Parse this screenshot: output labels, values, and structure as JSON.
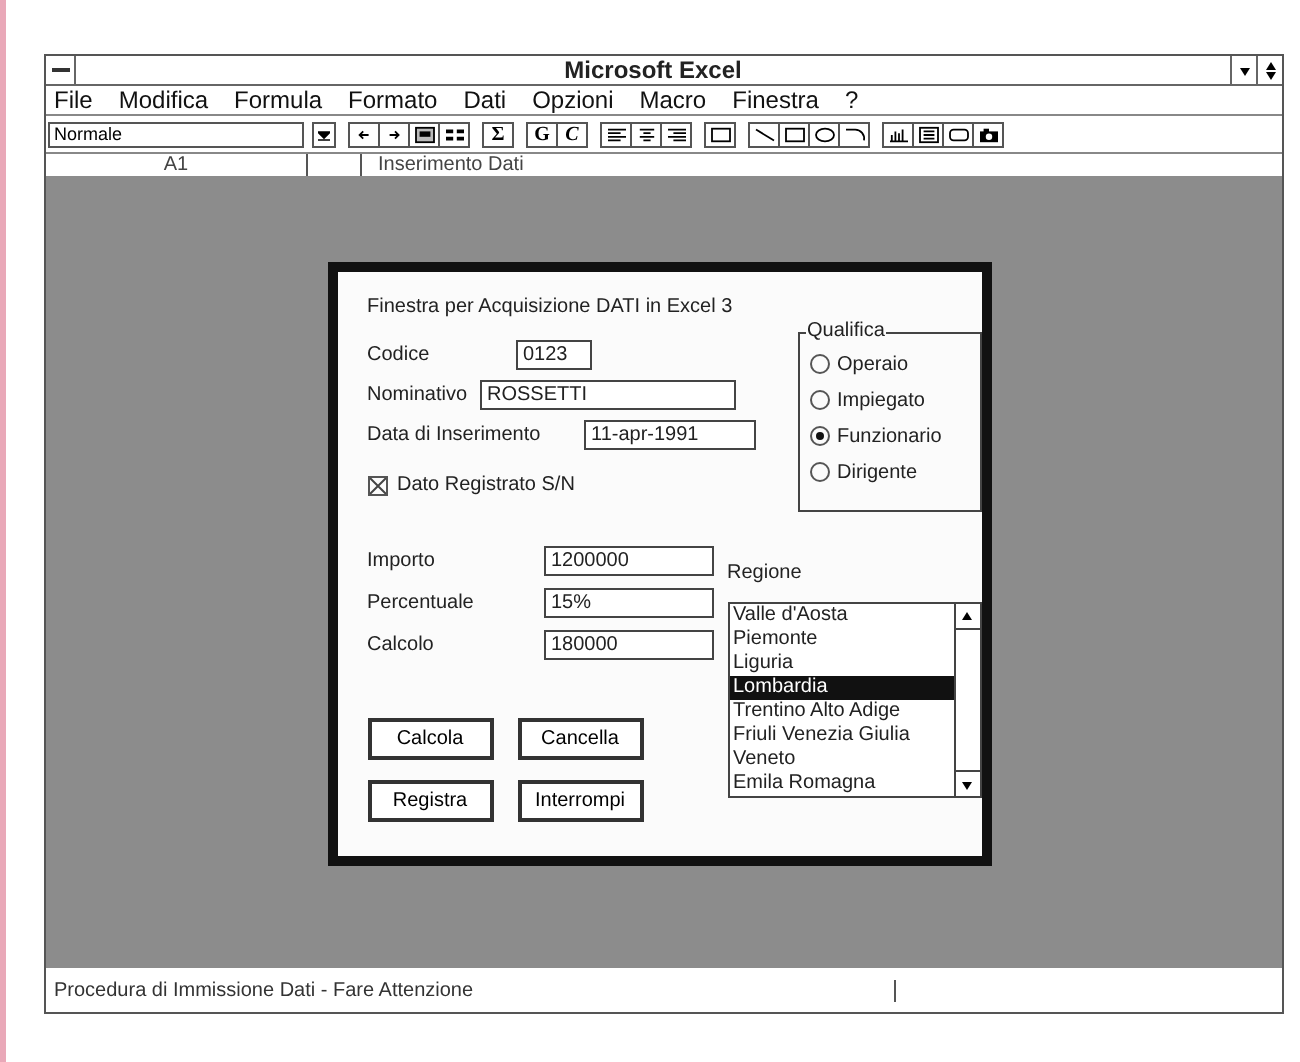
{
  "window": {
    "title": "Microsoft Excel"
  },
  "menu": [
    {
      "label": "File"
    },
    {
      "label": "Modifica"
    },
    {
      "label": "Formula"
    },
    {
      "label": "Formato"
    },
    {
      "label": "Dati"
    },
    {
      "label": "Opzioni"
    },
    {
      "label": "Macro"
    },
    {
      "label": "Finestra"
    },
    {
      "label": "?"
    }
  ],
  "toolbar": {
    "style": "Normale",
    "groups": [
      [
        {
          "kind": "promote"
        },
        {
          "kind": "demote"
        },
        {
          "kind": "outline"
        },
        {
          "kind": "show-outline"
        }
      ],
      [
        {
          "kind": "text",
          "label": "Σ"
        }
      ],
      [
        {
          "kind": "text",
          "label": "G"
        },
        {
          "kind": "italic",
          "label": "C"
        }
      ],
      [
        {
          "kind": "align-left"
        },
        {
          "kind": "align-center"
        },
        {
          "kind": "align-right"
        }
      ],
      [
        {
          "kind": "frame"
        }
      ],
      [
        {
          "kind": "line"
        },
        {
          "kind": "rect"
        },
        {
          "kind": "ellipse"
        },
        {
          "kind": "arc"
        }
      ],
      [
        {
          "kind": "chart"
        },
        {
          "kind": "textbox"
        },
        {
          "kind": "pushbutton"
        },
        {
          "kind": "camera"
        }
      ]
    ]
  },
  "formula_bar": {
    "cell": "A1",
    "content": "Inserimento Dati"
  },
  "dialog": {
    "title": "Finestra per Acquisizione DATI in Excel 3",
    "fields": [
      {
        "label": "Codice",
        "value": "0123"
      },
      {
        "label": "Nominativo",
        "value": "ROSSETTI"
      },
      {
        "label": "Data di Inserimento",
        "value": "11-apr-1991"
      }
    ],
    "checkbox": {
      "label": "Dato Registrato S/N",
      "checked": true
    },
    "qualifica": {
      "label": "Qualifica",
      "options": [
        {
          "label": "Operaio",
          "selected": false
        },
        {
          "label": "Impiegato",
          "selected": false
        },
        {
          "label": "Funzionario",
          "selected": true
        },
        {
          "label": "Dirigente",
          "selected": false
        }
      ]
    },
    "numbers": [
      {
        "label": "Importo",
        "value": "1200000"
      },
      {
        "label": "Percentuale",
        "value": "15%"
      },
      {
        "label": "Calcolo",
        "value": "180000"
      }
    ],
    "regione": {
      "label": "Regione",
      "items": [
        {
          "label": "Valle d'Aosta",
          "selected": false
        },
        {
          "label": "Piemonte",
          "selected": false
        },
        {
          "label": "Liguria",
          "selected": false
        },
        {
          "label": "Lombardia",
          "selected": true
        },
        {
          "label": "Trentino Alto Adige",
          "selected": false
        },
        {
          "label": "Friuli Venezia Giulia",
          "selected": false
        },
        {
          "label": "Veneto",
          "selected": false
        },
        {
          "label": "Emila Romagna",
          "selected": false
        }
      ]
    },
    "buttons": [
      {
        "label": "Calcola"
      },
      {
        "label": "Cancella"
      },
      {
        "label": "Registra"
      },
      {
        "label": "Interrompi"
      }
    ]
  },
  "status_bar": "Procedura di Immissione Dati - Fare Attenzione"
}
